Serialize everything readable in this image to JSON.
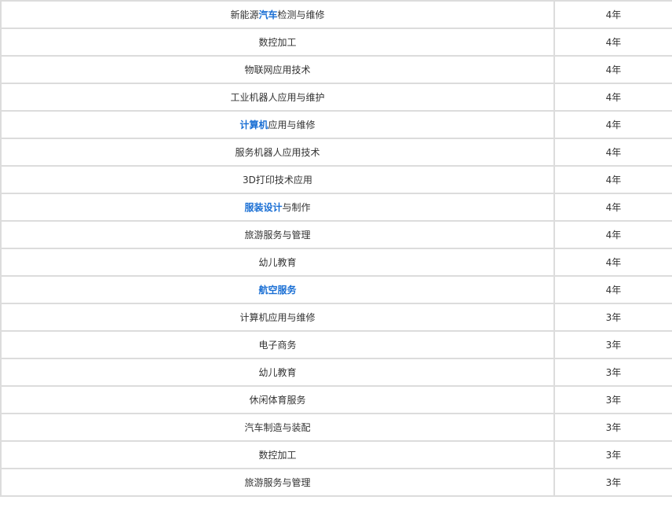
{
  "rows": [
    {
      "parts": [
        {
          "text": "新能源",
          "link": false
        },
        {
          "text": "汽车",
          "link": true
        },
        {
          "text": "检测与维修",
          "link": false
        }
      ],
      "years": "4年"
    },
    {
      "parts": [
        {
          "text": "数控加工",
          "link": false
        }
      ],
      "years": "4年"
    },
    {
      "parts": [
        {
          "text": "物联网应用技术",
          "link": false
        }
      ],
      "years": "4年"
    },
    {
      "parts": [
        {
          "text": "工业机器人应用与维护",
          "link": false
        }
      ],
      "years": "4年"
    },
    {
      "parts": [
        {
          "text": "计算机",
          "link": true
        },
        {
          "text": "应用与维修",
          "link": false
        }
      ],
      "years": "4年"
    },
    {
      "parts": [
        {
          "text": "服务机器人应用技术",
          "link": false
        }
      ],
      "years": "4年"
    },
    {
      "parts": [
        {
          "text": "3D打印技术应用",
          "link": false
        }
      ],
      "years": "4年"
    },
    {
      "parts": [
        {
          "text": "服装设计",
          "link": true
        },
        {
          "text": "与制作",
          "link": false
        }
      ],
      "years": "4年"
    },
    {
      "parts": [
        {
          "text": "旅游服务与管理",
          "link": false
        }
      ],
      "years": "4年"
    },
    {
      "parts": [
        {
          "text": "幼儿教育",
          "link": false
        }
      ],
      "years": "4年"
    },
    {
      "parts": [
        {
          "text": "航空服务",
          "link": true
        }
      ],
      "years": "4年"
    },
    {
      "parts": [
        {
          "text": "计算机应用与维修",
          "link": false
        }
      ],
      "years": "3年"
    },
    {
      "parts": [
        {
          "text": "电子商务",
          "link": false
        }
      ],
      "years": "3年"
    },
    {
      "parts": [
        {
          "text": "幼儿教育",
          "link": false
        }
      ],
      "years": "3年"
    },
    {
      "parts": [
        {
          "text": "休闲体育服务",
          "link": false
        }
      ],
      "years": "3年"
    },
    {
      "parts": [
        {
          "text": "汽车制造与装配",
          "link": false
        }
      ],
      "years": "3年"
    },
    {
      "parts": [
        {
          "text": "数控加工",
          "link": false
        }
      ],
      "years": "3年"
    },
    {
      "parts": [
        {
          "text": "旅游服务与管理",
          "link": false
        }
      ],
      "years": "3年"
    }
  ],
  "colors": {
    "link": "#1a6fd4",
    "text": "#333333",
    "border": "#dcdcdc"
  }
}
